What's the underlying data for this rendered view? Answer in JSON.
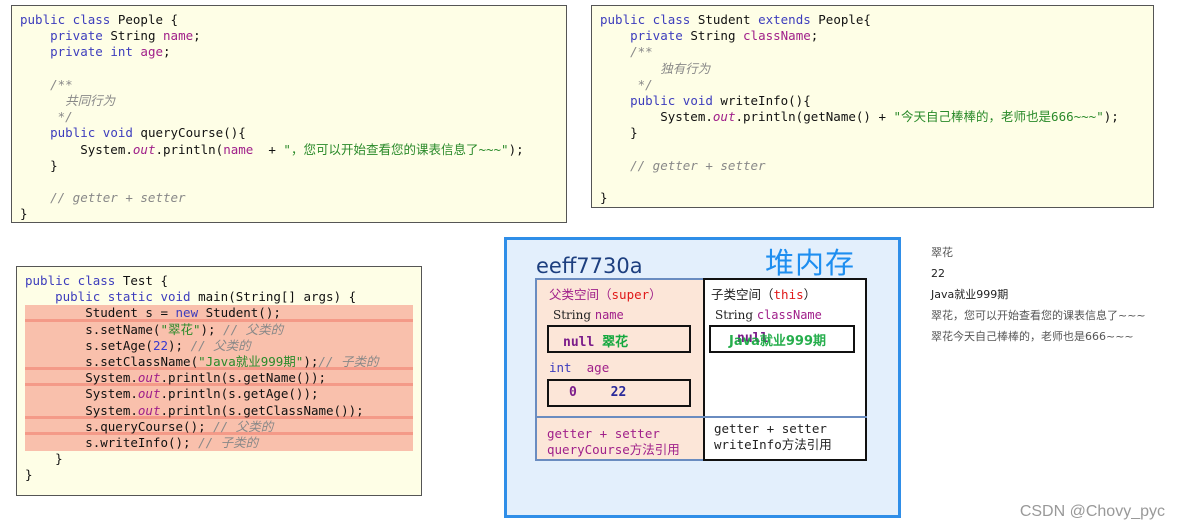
{
  "people_class": {
    "lines": [
      {
        "parts": [
          [
            "kw",
            "public class "
          ],
          [
            "",
            "People {"
          ]
        ]
      },
      {
        "parts": [
          [
            "",
            "    "
          ],
          [
            "kw",
            "private "
          ],
          [
            "",
            "String "
          ],
          [
            "fld",
            "name"
          ],
          [
            "",
            ";"
          ]
        ]
      },
      {
        "parts": [
          [
            "",
            "    "
          ],
          [
            "kw",
            "private int "
          ],
          [
            "fld",
            "age"
          ],
          [
            "",
            ";"
          ]
        ]
      },
      {
        "parts": [
          [
            "",
            ""
          ]
        ]
      },
      {
        "parts": [
          [
            "cm",
            "    /**"
          ]
        ]
      },
      {
        "parts": [
          [
            "cm",
            "      共同行为"
          ]
        ]
      },
      {
        "parts": [
          [
            "cm",
            "     */"
          ]
        ]
      },
      {
        "parts": [
          [
            "",
            "    "
          ],
          [
            "kw",
            "public void "
          ],
          [
            "",
            "queryCourse(){"
          ]
        ]
      },
      {
        "parts": [
          [
            "",
            "        System."
          ],
          [
            "st",
            "out"
          ],
          [
            "",
            ".println("
          ],
          [
            "fld",
            "name"
          ],
          [
            "",
            "  + "
          ],
          [
            "str",
            "\"，您可以开始查看您的课表信息了~~~\""
          ],
          [
            "",
            ");"
          ]
        ]
      },
      {
        "parts": [
          [
            "",
            "    }"
          ]
        ]
      },
      {
        "parts": [
          [
            "",
            ""
          ]
        ]
      },
      {
        "parts": [
          [
            "cm",
            "    // getter + setter"
          ]
        ]
      },
      {
        "parts": [
          [
            "",
            "}"
          ]
        ]
      }
    ]
  },
  "student_class": {
    "lines": [
      {
        "parts": [
          [
            "kw",
            "public class "
          ],
          [
            "",
            "Student "
          ],
          [
            "kw",
            "extends "
          ],
          [
            "",
            "People{"
          ]
        ]
      },
      {
        "parts": [
          [
            "",
            "    "
          ],
          [
            "kw",
            "private "
          ],
          [
            "",
            "String "
          ],
          [
            "fld",
            "className"
          ],
          [
            "",
            ";"
          ]
        ]
      },
      {
        "parts": [
          [
            "cm",
            "    /**"
          ]
        ]
      },
      {
        "parts": [
          [
            "cm",
            "        独有行为"
          ]
        ]
      },
      {
        "parts": [
          [
            "cm",
            "     */"
          ]
        ]
      },
      {
        "parts": [
          [
            "",
            "    "
          ],
          [
            "kw",
            "public void "
          ],
          [
            "",
            "writeInfo(){"
          ]
        ]
      },
      {
        "parts": [
          [
            "",
            "        System."
          ],
          [
            "st",
            "out"
          ],
          [
            "",
            ".println(getName() + "
          ],
          [
            "str",
            "\"今天自己棒棒的，老师也是666~~~\""
          ],
          [
            "",
            ");"
          ]
        ]
      },
      {
        "parts": [
          [
            "",
            "    }"
          ]
        ]
      },
      {
        "parts": [
          [
            "",
            ""
          ]
        ]
      },
      {
        "parts": [
          [
            "cm",
            "    // getter + setter"
          ]
        ]
      },
      {
        "parts": [
          [
            "",
            ""
          ]
        ]
      },
      {
        "parts": [
          [
            "",
            "}"
          ]
        ]
      }
    ]
  },
  "test_class": {
    "lines": [
      {
        "hl": false,
        "parts": [
          [
            "kw",
            "public class "
          ],
          [
            "",
            "Test {"
          ]
        ]
      },
      {
        "hl": false,
        "parts": [
          [
            "",
            "    "
          ],
          [
            "kw",
            "public static void "
          ],
          [
            "",
            "main(String[] args) {"
          ]
        ]
      },
      {
        "hl": true,
        "sep": true,
        "parts": [
          [
            "",
            "        Student s = "
          ],
          [
            "kw",
            "new "
          ],
          [
            "",
            "Student();"
          ]
        ]
      },
      {
        "hl": true,
        "parts": [
          [
            "",
            "        s.setName("
          ],
          [
            "str",
            "\"翠花\""
          ],
          [
            "",
            "); "
          ],
          [
            "cm",
            "// 父类的"
          ]
        ]
      },
      {
        "hl": true,
        "parts": [
          [
            "",
            "        s.setAge("
          ],
          [
            "num",
            "22"
          ],
          [
            "",
            "); "
          ],
          [
            "cm",
            "// 父类的"
          ]
        ]
      },
      {
        "hl": true,
        "sep": true,
        "parts": [
          [
            "",
            "        s.setClassName("
          ],
          [
            "str",
            "\"Java就业999期\""
          ],
          [
            "",
            ");"
          ],
          [
            "cm",
            "// 子类的"
          ]
        ]
      },
      {
        "hl": true,
        "sep": true,
        "parts": [
          [
            "",
            "        System."
          ],
          [
            "st",
            "out"
          ],
          [
            "",
            ".println(s.getName());"
          ]
        ]
      },
      {
        "hl": true,
        "parts": [
          [
            "",
            "        System."
          ],
          [
            "st",
            "out"
          ],
          [
            "",
            ".println(s.getAge());"
          ]
        ]
      },
      {
        "hl": true,
        "sep": true,
        "parts": [
          [
            "",
            "        System."
          ],
          [
            "st",
            "out"
          ],
          [
            "",
            ".println(s.getClassName());"
          ]
        ]
      },
      {
        "hl": true,
        "sep": true,
        "parts": [
          [
            "",
            "        s.queryCourse(); "
          ],
          [
            "cm",
            "// 父类的"
          ]
        ]
      },
      {
        "hl": true,
        "parts": [
          [
            "",
            "        s.writeInfo(); "
          ],
          [
            "cm",
            "// 子类的"
          ]
        ]
      },
      {
        "hl": false,
        "parts": [
          [
            "",
            "    }"
          ]
        ]
      },
      {
        "hl": false,
        "parts": [
          [
            "",
            "}"
          ]
        ]
      }
    ]
  },
  "heap": {
    "title": "堆内存",
    "address": "eeff7730a",
    "super_space": {
      "title_prefix": "父类空间（",
      "title_keyword": "super",
      "title_suffix": "）",
      "name_type": "String",
      "name_field": "name",
      "name_old_value": "null",
      "name_new_value": "翠花",
      "age_type": "int",
      "age_field": "age",
      "age_old_value": "0",
      "age_new_value": "22",
      "methods_line1": "getter + setter",
      "methods_line2": "queryCourse方法引用"
    },
    "this_space": {
      "title_prefix": "子类空间（",
      "title_keyword": "this",
      "title_suffix": "）",
      "class_type": "String",
      "class_field": "className",
      "class_old_value": "null",
      "class_new_value": "Java就业999期",
      "methods_line1": "getter + setter",
      "methods_line2": "writeInfo方法引用"
    }
  },
  "console_output": [
    "翠花",
    "22",
    "Java就业999期",
    "翠花，您可以开始查看您的课表信息了~~~",
    "翠花今天自己棒棒的，老师也是666~~~"
  ],
  "watermark": "CSDN @Chovy_pyc"
}
